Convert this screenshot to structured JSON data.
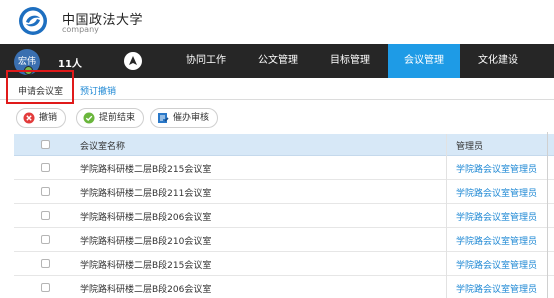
{
  "brand": {
    "name": "中国政法大学",
    "subtitle": "company"
  },
  "user": {
    "avatar_text": "宏伟",
    "count": "11人"
  },
  "nav": {
    "items": [
      {
        "label": "协同工作",
        "active": false
      },
      {
        "label": "公文管理",
        "active": false
      },
      {
        "label": "目标管理",
        "active": false
      },
      {
        "label": "会议管理",
        "active": true
      },
      {
        "label": "文化建设",
        "active": false
      }
    ]
  },
  "subtabs": {
    "apply": "申请会议室",
    "cancel": "预订撤销"
  },
  "toolbar": {
    "revoke": "撤销",
    "finish_early": "提前结束",
    "urge_review": "催办审核"
  },
  "table": {
    "headers": {
      "name": "会议室名称",
      "admin": "管理员"
    },
    "rows": [
      {
        "name": "学院路科研楼二层B段215会议室",
        "admin": "学院路会议室管理员"
      },
      {
        "name": "学院路科研楼二层B段211会议室",
        "admin": "学院路会议室管理员"
      },
      {
        "name": "学院路科研楼二层B段206会议室",
        "admin": "学院路会议室管理员"
      },
      {
        "name": "学院路科研楼二层B段210会议室",
        "admin": "学院路会议室管理员"
      },
      {
        "name": "学院路科研楼二层B段215会议室",
        "admin": "学院路会议室管理员"
      },
      {
        "name": "学院路科研楼二层B段206会议室",
        "admin": "学院路会议室管理员"
      }
    ]
  },
  "colors": {
    "nav_bg": "#262626",
    "accent": "#1e9be6",
    "link": "#1e88d4",
    "highlight": "#e01a1a",
    "table_header": "#d7e8f7"
  }
}
